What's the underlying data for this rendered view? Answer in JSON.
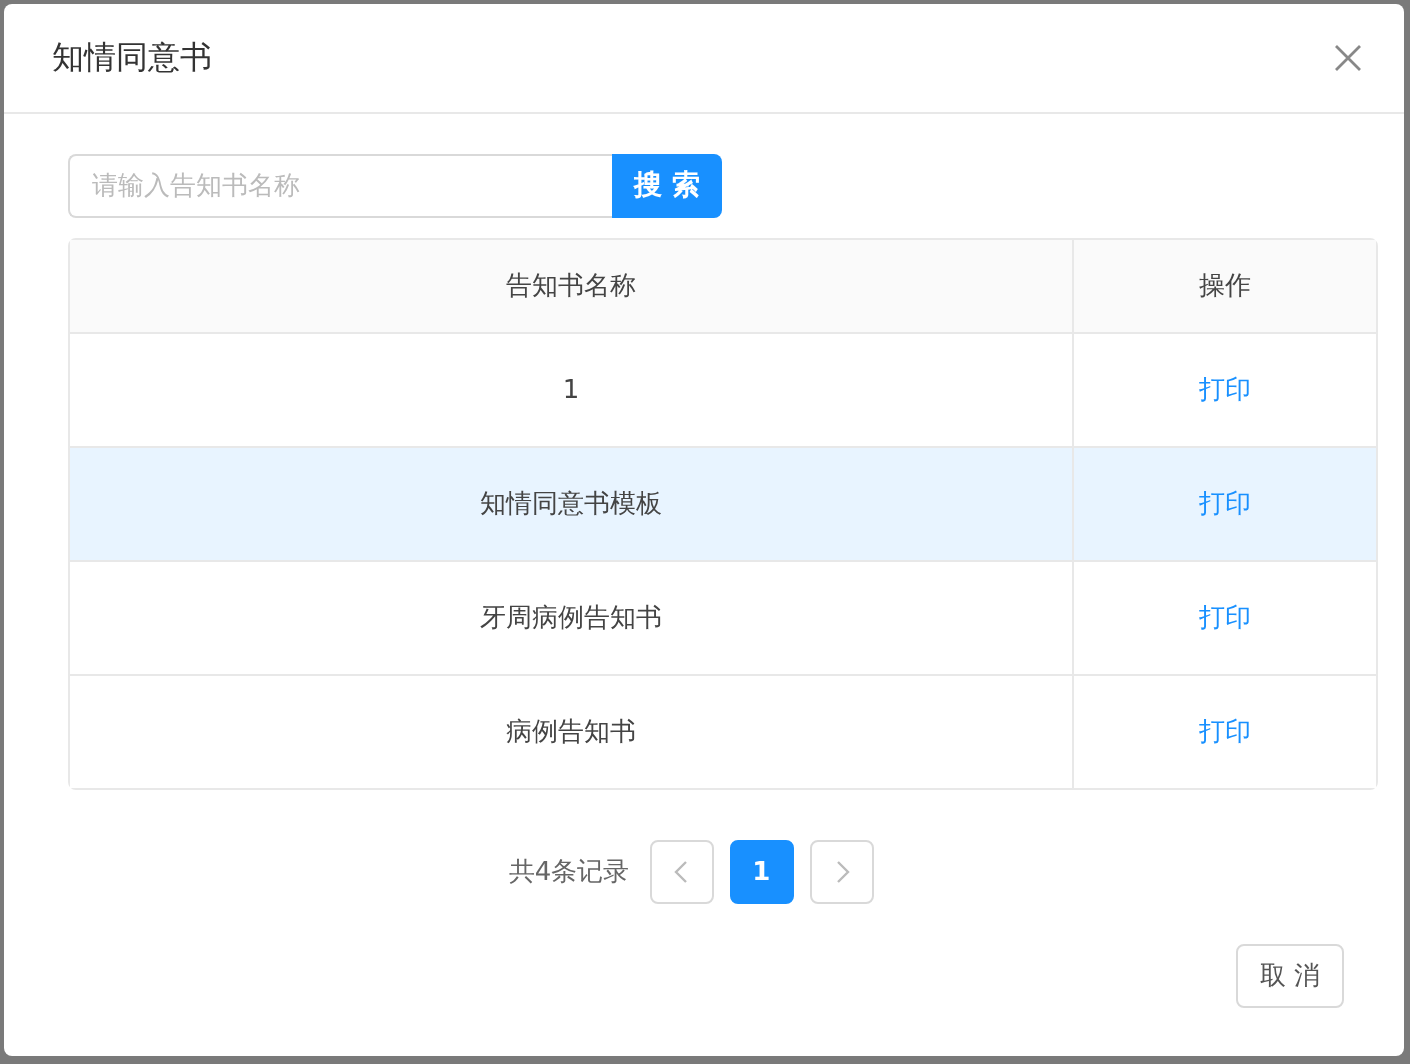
{
  "dialog": {
    "title": "知情同意书"
  },
  "search": {
    "placeholder": "请输入告知书名称",
    "button": "搜 索"
  },
  "table": {
    "columns": [
      "告知书名称",
      "操作"
    ],
    "rows": [
      {
        "name": "1",
        "action": "打印",
        "highlighted": false
      },
      {
        "name": "知情同意书模板",
        "action": "打印",
        "highlighted": true
      },
      {
        "name": "牙周病例告知书",
        "action": "打印",
        "highlighted": false
      },
      {
        "name": "病例告知书",
        "action": "打印",
        "highlighted": false
      }
    ]
  },
  "pagination": {
    "total": "共4条记录",
    "pages": [
      {
        "label": "1",
        "selected": true
      }
    ]
  },
  "footer": {
    "cancel": "取 消"
  }
}
